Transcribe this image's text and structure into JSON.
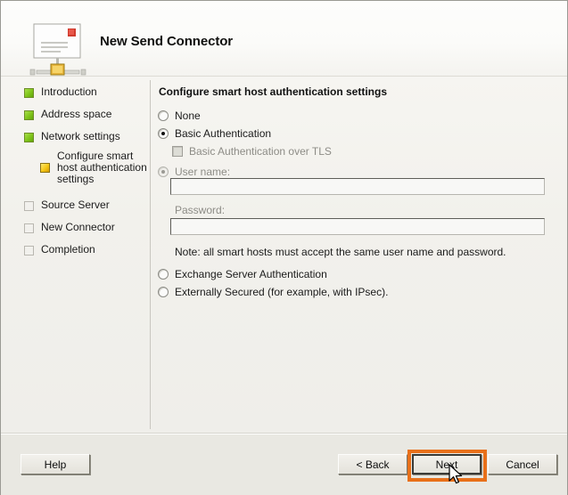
{
  "window": {
    "title": "New Send Connector",
    "icon": "send-connector-icon"
  },
  "sidebar": {
    "steps": [
      {
        "label": "Introduction",
        "state": "done",
        "marker": "green-square-icon"
      },
      {
        "label": "Address space",
        "state": "done",
        "marker": "green-square-icon"
      },
      {
        "label": "Network settings",
        "state": "done",
        "marker": "green-square-icon"
      },
      {
        "label": "Configure smart host authentication settings",
        "state": "current",
        "marker": "yellow-square-icon"
      },
      {
        "label": "Source Server",
        "state": "pending",
        "marker": "empty-square-icon"
      },
      {
        "label": "New Connector",
        "state": "pending",
        "marker": "empty-square-icon"
      },
      {
        "label": "Completion",
        "state": "pending",
        "marker": "empty-square-icon"
      }
    ]
  },
  "content": {
    "section_title": "Configure smart host authentication settings",
    "options": {
      "none": "None",
      "basic": "Basic Authentication",
      "basic_tls": "Basic Authentication over TLS",
      "exchange": "Exchange Server Authentication",
      "external": "Externally Secured (for example, with IPsec)."
    },
    "fields": {
      "username_label": "User name:",
      "username_value": "",
      "password_label": "Password:",
      "password_value": ""
    },
    "note": "Note: all smart hosts must accept the same user name and password."
  },
  "footer": {
    "help": "Help",
    "back": "< Back",
    "next": "Next",
    "cancel": "Cancel"
  },
  "annotation": {
    "highlight_color": "#e8701a",
    "highlighted_control": "next-button"
  }
}
